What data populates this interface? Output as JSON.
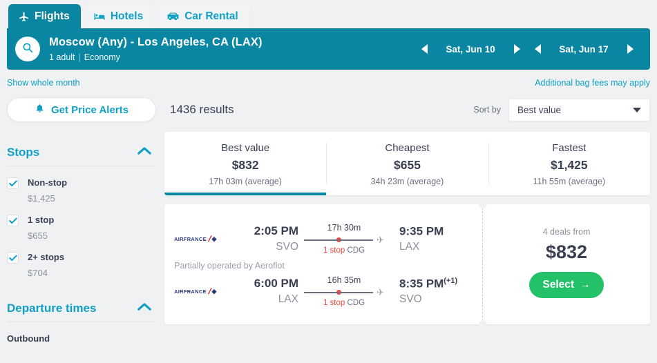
{
  "tabs": [
    {
      "label": "Flights",
      "icon": "plane-icon",
      "active": true
    },
    {
      "label": "Hotels",
      "icon": "bed-icon",
      "active": false
    },
    {
      "label": "Car Rental",
      "icon": "car-icon",
      "active": false
    }
  ],
  "search": {
    "route": "Moscow (Any) - Los Angeles, CA (LAX)",
    "passengers": "1 adult",
    "cabin": "Economy",
    "depart_date": "Sat, Jun 10",
    "return_date": "Sat, Jun 17"
  },
  "sublinks": {
    "show_whole_month": "Show whole month",
    "bag_fees": "Additional bag fees may apply"
  },
  "toolbar": {
    "price_alerts": "Get Price Alerts",
    "results": "1436 results",
    "sort_by": "Sort by",
    "sort_value": "Best value",
    "sort_options": [
      "Best value",
      "Cheapest",
      "Fastest"
    ]
  },
  "sidebar": {
    "stops": {
      "title": "Stops",
      "options": [
        {
          "label": "Non-stop",
          "price": "$1,425",
          "checked": true
        },
        {
          "label": "1 stop",
          "price": "$655",
          "checked": true
        },
        {
          "label": "2+ stops",
          "price": "$704",
          "checked": true
        }
      ]
    },
    "departure_times": {
      "title": "Departure times",
      "outbound_label": "Outbound"
    }
  },
  "value_tabs": [
    {
      "label": "Best value",
      "price": "$832",
      "duration": "17h 03m (average)",
      "active": true
    },
    {
      "label": "Cheapest",
      "price": "$655",
      "duration": "34h 23m (average)",
      "active": false
    },
    {
      "label": "Fastest",
      "price": "$1,425",
      "duration": "11h 55m (average)",
      "active": false
    }
  ],
  "flight": {
    "airline": "AIRFRANCE",
    "operated_note": "Partially operated by Aeroflot",
    "legs": [
      {
        "depart_time": "2:05 PM",
        "depart_code": "SVO",
        "duration": "17h 30m",
        "stops": "1 stop",
        "stop_code": "CDG",
        "arrive_time": "9:35 PM",
        "arrive_day_offset": "",
        "arrive_code": "LAX"
      },
      {
        "depart_time": "6:00 PM",
        "depart_code": "LAX",
        "duration": "16h 35m",
        "stops": "1 stop",
        "stop_code": "CDG",
        "arrive_time": "8:35 PM",
        "arrive_day_offset": "(+1)",
        "arrive_code": "SVO"
      }
    ],
    "deals": "4 deals from",
    "price": "$832",
    "select_label": "Select"
  },
  "colors": {
    "teal": "#0a86a3",
    "teal_light": "#10a0c4",
    "green": "#23c268",
    "red": "#f0453e",
    "page_bg": "#f0f1f3"
  }
}
